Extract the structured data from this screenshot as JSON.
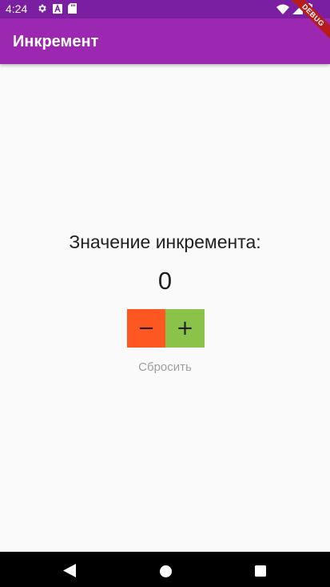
{
  "status_bar": {
    "time": "4:24",
    "icons_left": [
      "gear-icon",
      "font-icon",
      "sd-card-icon"
    ],
    "icons_right": [
      "wifi-icon",
      "signal-icon",
      "battery-icon"
    ],
    "color": "#7b1fa2"
  },
  "app_bar": {
    "title": "Инкремент",
    "color": "#9c27b0"
  },
  "debug_banner": {
    "label": "DEBUG",
    "color": "#b71c1c"
  },
  "main": {
    "label": "Значение инкремента:",
    "value": "0",
    "decrement_label": "−",
    "increment_label": "+",
    "decrement_color": "#ff5722",
    "increment_color": "#8bc34a",
    "reset_label": "Сбросить"
  },
  "nav_bar": {
    "buttons": [
      "back-icon",
      "home-icon",
      "recents-icon"
    ]
  }
}
